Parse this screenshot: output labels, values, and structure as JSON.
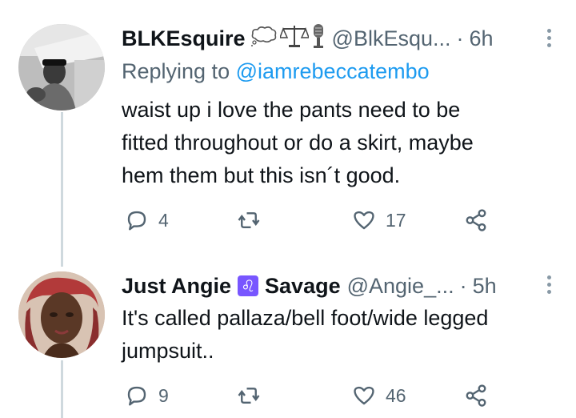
{
  "tweets": [
    {
      "name": "BLKEsquire",
      "emoji_icons": [
        "thought-balloon-icon",
        "scales-icon",
        "microphone-icon"
      ],
      "handle": "@BlkEsqu...",
      "dot": "·",
      "time": "6h",
      "replying_prefix": "Replying to",
      "replying_to": "@iamrebeccatembo",
      "text_lines": [
        "waist up i love the pants need to be",
        "fitted throughout or do a skirt, maybe",
        "hem them but this isn´t good."
      ],
      "replies": "4",
      "retweets": "",
      "likes": "17"
    },
    {
      "name": "Just Angie",
      "badge_icon": "leo-icon",
      "badge_glyph": "♌",
      "name_suffix": "Savage",
      "handle": "@Angie_...",
      "dot": "·",
      "time": "5h",
      "text_lines": [
        "It's called pallaza/bell foot/wide legged",
        "jumpsuit.."
      ],
      "replies": "9",
      "retweets": "",
      "likes": "46"
    }
  ],
  "colors": {
    "text": "#0f1419",
    "secondary": "#536471",
    "link": "#1d9bf0",
    "thread_line": "#cfd9de"
  }
}
